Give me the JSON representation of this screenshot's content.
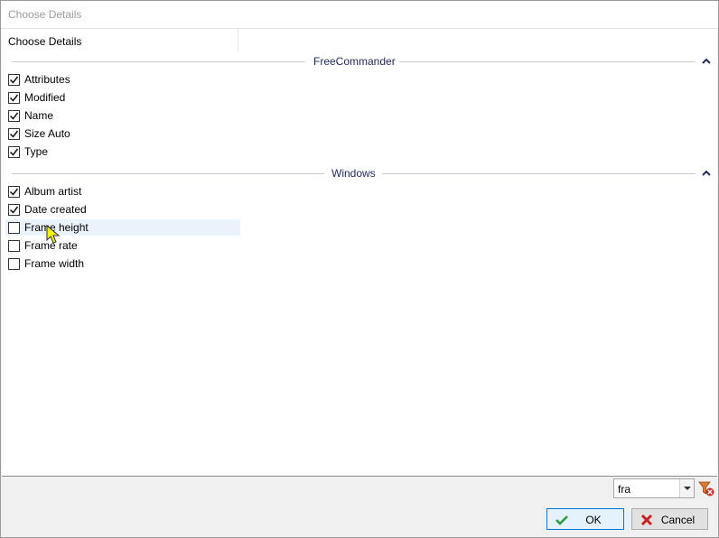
{
  "window": {
    "title": "Choose Details"
  },
  "column_header": {
    "label": "Choose Details"
  },
  "groups": [
    {
      "title": "FreeCommander",
      "items": [
        {
          "label": "Attributes",
          "checked": true
        },
        {
          "label": "Modified",
          "checked": true
        },
        {
          "label": "Name",
          "checked": true
        },
        {
          "label": "Size Auto",
          "checked": true
        },
        {
          "label": "Type",
          "checked": true
        }
      ]
    },
    {
      "title": "Windows",
      "items": [
        {
          "label": "Album artist",
          "checked": true
        },
        {
          "label": "Date created",
          "checked": true
        },
        {
          "label": "Frame height",
          "checked": false
        },
        {
          "label": "Frame rate",
          "checked": false
        },
        {
          "label": "Frame width",
          "checked": false
        }
      ]
    }
  ],
  "filter": {
    "value": "fra"
  },
  "buttons": {
    "ok_label": "OK",
    "cancel_label": "Cancel"
  },
  "icons": {
    "collapse": "chevron-up-icon",
    "clear_filter": "filter-clear-icon",
    "ok": "checkmark-icon",
    "cancel": "cross-icon"
  },
  "colors": {
    "group_title": "#1f2a5c",
    "hover_row": "#eaf3fb",
    "ok_border": "#0078d7"
  }
}
